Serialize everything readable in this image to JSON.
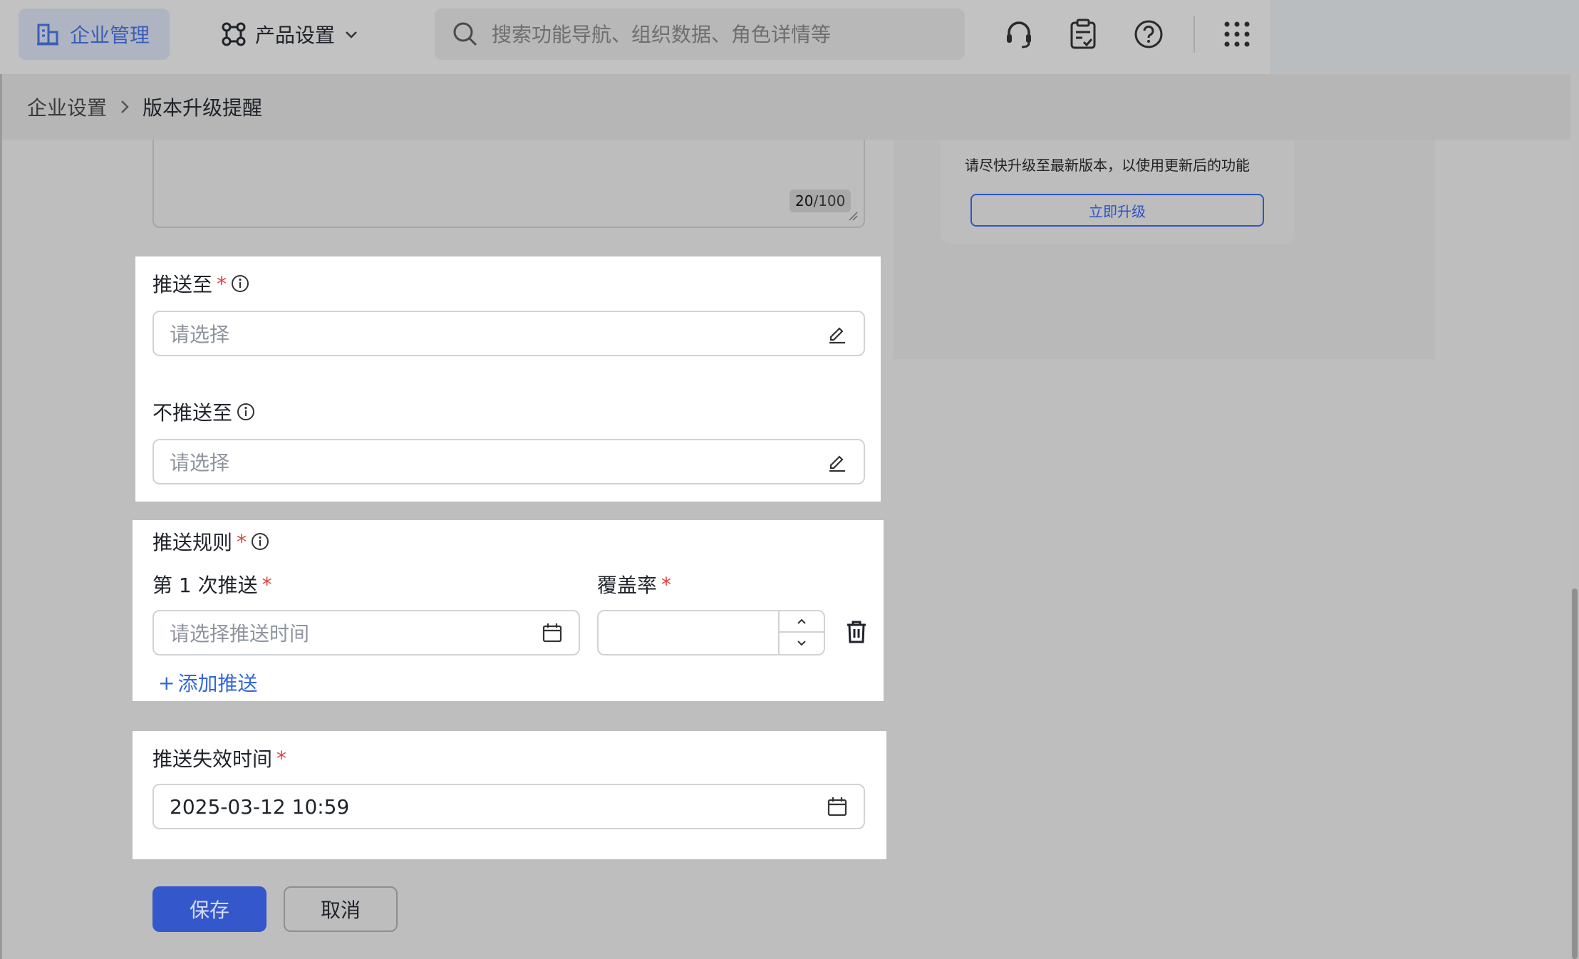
{
  "header": {
    "brand_label": "企业管理",
    "product_label": "产品设置",
    "search_placeholder": "搜索功能导航、组织数据、角色详情等"
  },
  "breadcrumb": {
    "parent": "企业设置",
    "separator": ">",
    "current": "版本升级提醒"
  },
  "textarea": {
    "count": "20",
    "max": "/100"
  },
  "preview": {
    "message": "请尽快升级至最新版本，以使用更新后的功能",
    "button_label": "立即升级"
  },
  "form": {
    "push_to": {
      "label": "推送至",
      "placeholder": "请选择"
    },
    "not_push_to": {
      "label": "不推送至",
      "placeholder": "请选择"
    },
    "push_rules": {
      "label": "推送规则",
      "first_push_label": "第 1 次推送",
      "first_push_placeholder": "请选择推送时间",
      "coverage_label": "覆盖率",
      "add_push_label": "添加推送",
      "add_symbol": "+"
    },
    "expire": {
      "label": "推送失效时间",
      "value": "2025-03-12 10:59"
    },
    "required_mark": "*"
  },
  "actions": {
    "save_label": "保存",
    "cancel_label": "取消"
  },
  "colors": {
    "accent": "#3457cc",
    "required": "#e0413d",
    "link": "#3366dd"
  }
}
